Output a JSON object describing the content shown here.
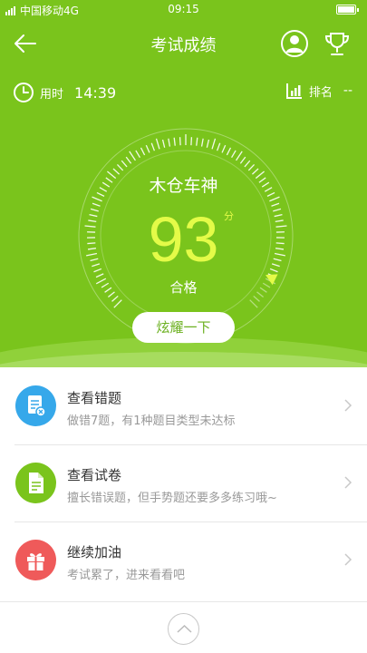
{
  "status_bar": {
    "carrier": "中国移动4G",
    "time": "09:15",
    "icons": [
      "signal-icon",
      "battery-icon"
    ]
  },
  "nav": {
    "title": "考试成绩",
    "icons": [
      "back-arrow-icon",
      "profile-icon",
      "trophy-icon"
    ]
  },
  "info": {
    "time_label": "用时",
    "time_value": "14:39",
    "rank_label": "排名",
    "rank_value": "--",
    "icons": [
      "clock-icon",
      "bar-chart-icon"
    ]
  },
  "result": {
    "nickname": "木仓车神",
    "score": "93",
    "score_unit": "分",
    "status": "合格",
    "gauge_fraction": 0.93,
    "share_button": "炫耀一下"
  },
  "list": [
    {
      "title": "查看错题",
      "desc": "做错7题，有1种题目类型未达标",
      "icon": "wrong-answers-icon",
      "color": "#36a8ea"
    },
    {
      "title": "查看试卷",
      "desc": "擅长错误题，但手势题还要多多练习哦~",
      "icon": "exam-paper-icon",
      "color": "#7ac41c"
    },
    {
      "title": "继续加油",
      "desc": "考试累了，进来看看吧",
      "icon": "gift-icon",
      "color": "#ef5a5a"
    }
  ],
  "bottom": {
    "icon": "chevron-up-icon"
  },
  "colors": {
    "primary_green": "#7ac41c",
    "score_yellow": "#e4fb48",
    "blue": "#36a8ea",
    "red": "#ef5a5a"
  }
}
